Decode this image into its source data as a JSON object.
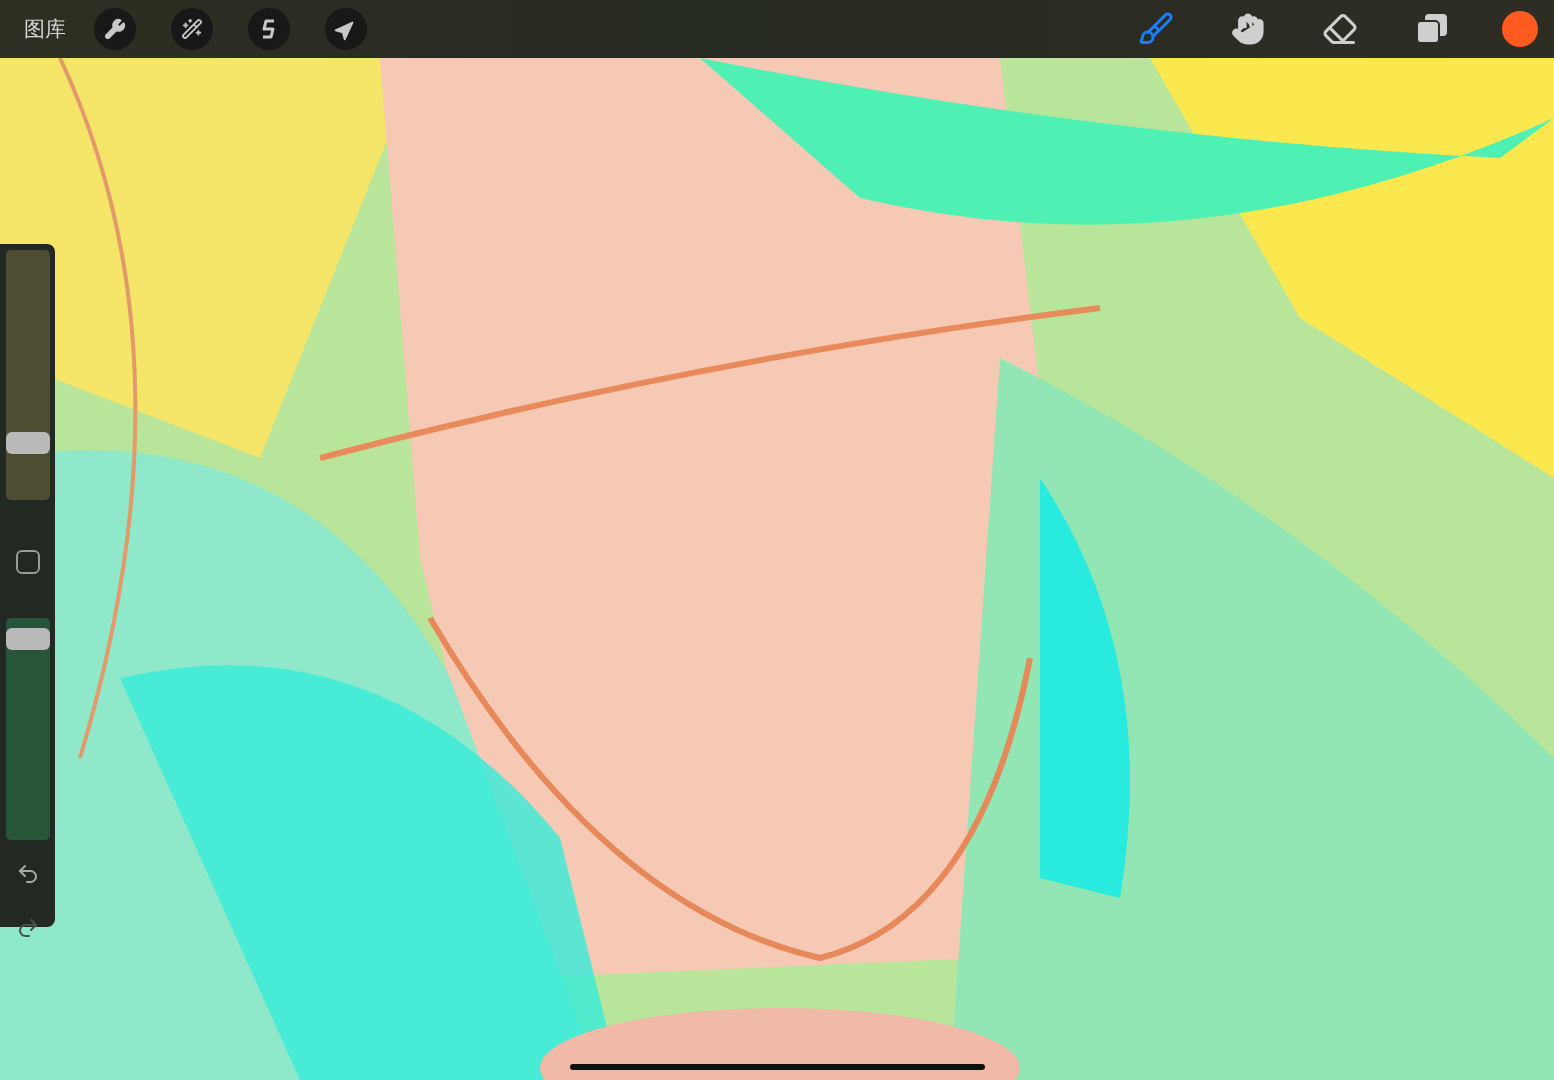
{
  "top_bar": {
    "gallery": "图库",
    "left_tools": [
      {
        "kind": "wrench"
      },
      {
        "kind": "wand"
      },
      {
        "kind": "selection"
      },
      {
        "kind": "transform"
      }
    ],
    "right_tools": [
      {
        "kind": "brush",
        "selected": true
      },
      {
        "kind": "smudge",
        "selected": false
      },
      {
        "kind": "eraser",
        "selected": false
      },
      {
        "kind": "layers",
        "selected": false
      }
    ],
    "color": "#ff5a1f"
  },
  "sidebar": {
    "size_slider": {
      "level": 0.2
    },
    "opacity_slider": {
      "level": 0.95
    },
    "undo": {
      "disabled": false
    },
    "redo": {
      "disabled": true
    }
  }
}
